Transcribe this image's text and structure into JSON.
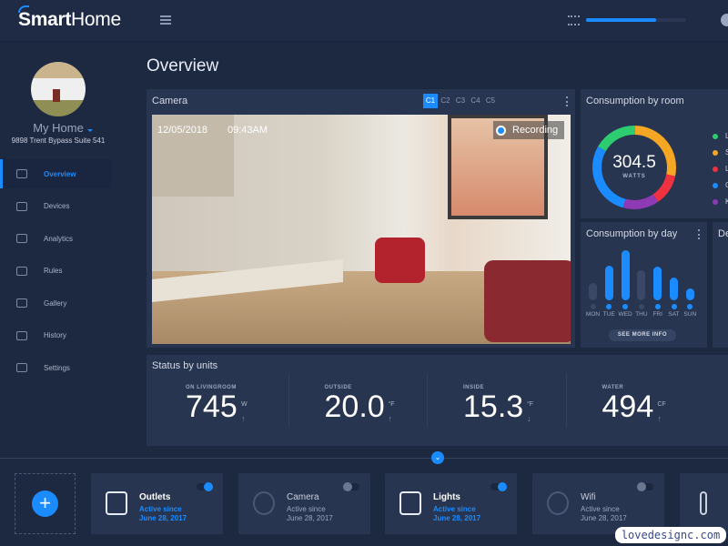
{
  "app": {
    "brand_bold": "Smart",
    "brand_light": "Home",
    "progress_percent": 70
  },
  "sidebar": {
    "home_name": "My Home",
    "address": "9898 Trent Bypass Suite 541",
    "items": [
      {
        "label": "Overview",
        "icon": "home-icon",
        "active": true
      },
      {
        "label": "Devices",
        "icon": "devices-icon"
      },
      {
        "label": "Analytics",
        "icon": "analytics-icon"
      },
      {
        "label": "Rules",
        "icon": "rules-icon"
      },
      {
        "label": "Gallery",
        "icon": "gallery-icon"
      },
      {
        "label": "History",
        "icon": "history-icon"
      },
      {
        "label": "Settings",
        "icon": "gear-icon"
      }
    ]
  },
  "page": {
    "title": "Overview"
  },
  "camera": {
    "title": "Camera",
    "channels": [
      "C1",
      "C2",
      "C3",
      "C4",
      "C5"
    ],
    "active_channel": "C1",
    "date": "12/05/2018",
    "time": "09:43AM",
    "recording_label": "Recording"
  },
  "consumption_room": {
    "title": "Consumption by room",
    "total": "304.5",
    "unit": "WATTS",
    "legend": [
      {
        "label": "L",
        "color": "#2ecc71"
      },
      {
        "label": "S",
        "color": "#f5a623"
      },
      {
        "label": "L",
        "color": "#f0313f"
      },
      {
        "label": "G",
        "color": "#1a8cff"
      },
      {
        "label": "K",
        "color": "#8e3ab5"
      }
    ]
  },
  "consumption_day": {
    "title": "Consumption by day",
    "see_more": "SEE MORE INFO"
  },
  "third_panel": {
    "title": "De"
  },
  "chart_data": [
    {
      "type": "pie",
      "title": "Consumption by room",
      "labels": [
        "L",
        "S",
        "L",
        "G",
        "K"
      ],
      "values": [
        17,
        28,
        12,
        29,
        14
      ],
      "colors": [
        "#2ecc71",
        "#f5a623",
        "#f0313f",
        "#1a8cff",
        "#8e3ab5"
      ],
      "center_value": "304.5",
      "center_unit": "WATTS",
      "legend": "right"
    },
    {
      "type": "bar",
      "title": "Consumption by day",
      "categories": [
        "MON",
        "TUE",
        "WED",
        "THU",
        "FRI",
        "SAT",
        "SUN"
      ],
      "values": [
        17,
        35,
        50,
        30,
        34,
        23,
        12
      ],
      "active": [
        false,
        true,
        true,
        false,
        true,
        true,
        true
      ],
      "colors": {
        "active": "#1a8cff",
        "inactive": "#3a4866"
      }
    }
  ],
  "status": {
    "title": "Status by units",
    "items": [
      {
        "label": "ON LIVINGROOM",
        "value": "745",
        "unit": "W",
        "trend": "↑"
      },
      {
        "label": "OUTSIDE",
        "value": "20.0",
        "unit": "°F",
        "trend": "↑"
      },
      {
        "label": "INSIDE",
        "value": "15.3",
        "unit": "°F",
        "trend": "↓"
      },
      {
        "label": "WATER",
        "value": "494",
        "unit": "CF",
        "trend": "↑"
      }
    ]
  },
  "devices": [
    {
      "name": "Outlets",
      "line1": "Active since",
      "line2": "June 28, 2017",
      "on": true,
      "icon": "outlet-icon"
    },
    {
      "name": "Camera",
      "line1": "Active since",
      "line2": "June 28, 2017",
      "on": false,
      "icon": "webcam-icon"
    },
    {
      "name": "Lights",
      "line1": "Active since",
      "line2": "June 28, 2017",
      "on": true,
      "icon": "lightbulb-icon"
    },
    {
      "name": "Wifi",
      "line1": "Active since",
      "line2": "June 28, 2017",
      "on": false,
      "icon": "wifi-icon"
    }
  ],
  "add_button": "+",
  "watermark": "lovedesignc.com"
}
